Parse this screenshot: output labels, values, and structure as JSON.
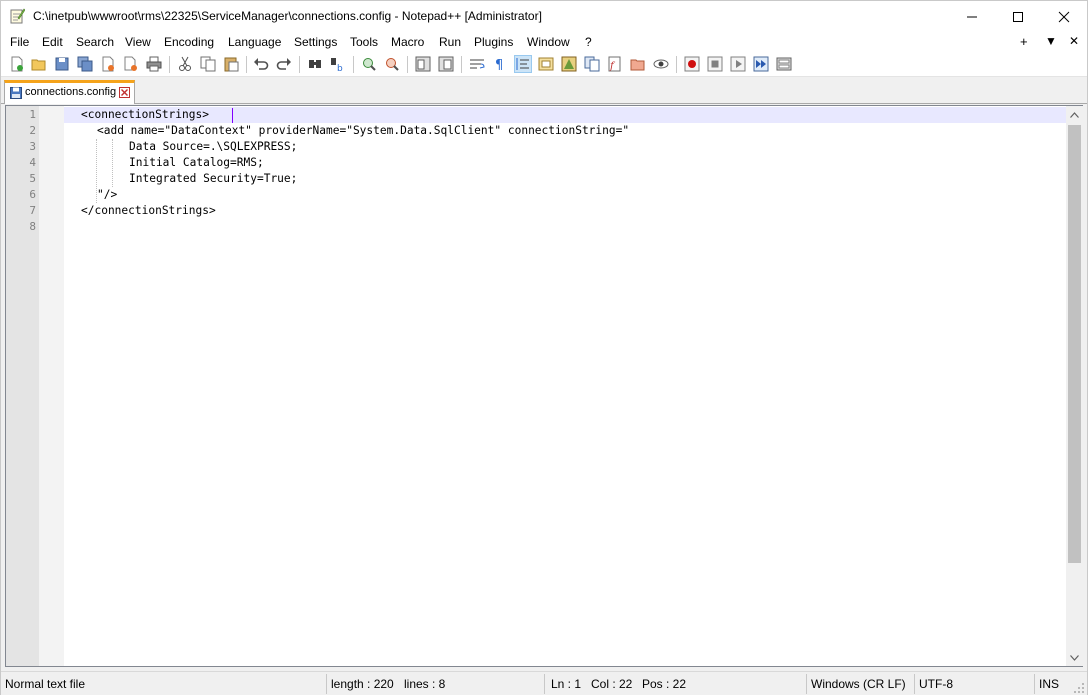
{
  "window": {
    "title": "C:\\inetpub\\wwwroot\\rms\\22325\\ServiceManager\\connections.config - Notepad++ [Administrator]"
  },
  "menu": {
    "items": [
      "File",
      "Edit",
      "Search",
      "View",
      "Encoding",
      "Language",
      "Settings",
      "Tools",
      "Macro",
      "Run",
      "Plugins",
      "Window",
      "?"
    ],
    "right_glyphs": [
      "+",
      "▼",
      "✕"
    ]
  },
  "tab": {
    "label": "connections.config"
  },
  "editor": {
    "line_numbers": [
      "1",
      "2",
      "3",
      "4",
      "5",
      "6",
      "7",
      "8"
    ],
    "lines": [
      "<connectionStrings>",
      "<add name=\"DataContext\" providerName=\"System.Data.SqlClient\" connectionString=\"",
      "Data Source=.\\SQLEXPRESS;",
      "Initial Catalog=RMS;",
      "Integrated Security=True;",
      "\"/>",
      "</connectionStrings>",
      ""
    ]
  },
  "status": {
    "file_type": "Normal text file",
    "length": "length : 220",
    "lines": "lines : 8",
    "ln": "Ln : 1",
    "col": "Col : 22",
    "pos": "Pos : 22",
    "eol": "Windows (CR LF)",
    "encoding": "UTF-8",
    "mode": "INS"
  },
  "colors": {
    "tab_accent": "#f5a31a",
    "current_line": "#e8e8ff",
    "caret": "#8000ff",
    "gutter": "#e4e4e4"
  }
}
